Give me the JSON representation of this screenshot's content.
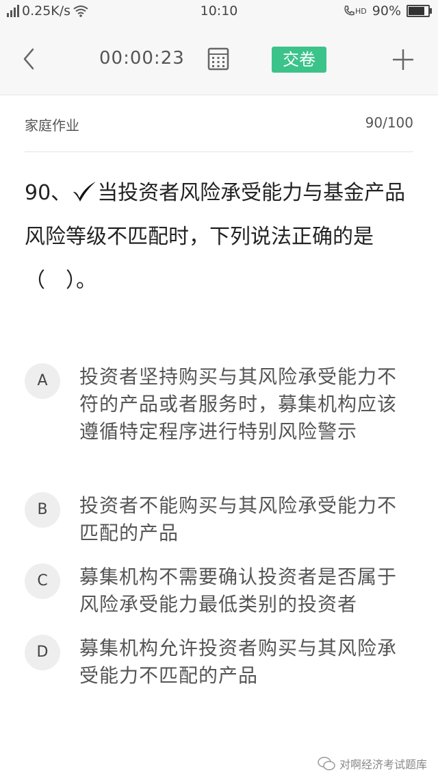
{
  "status": {
    "network_speed": "0.25K/s",
    "time": "10:10",
    "hd_label": "HD",
    "battery": "90%",
    "battery_level": 0.9
  },
  "toolbar": {
    "timer": "00:00:23",
    "submit_label": "交卷"
  },
  "section": {
    "title": "家庭作业",
    "progress": "90/100"
  },
  "question": {
    "number": "90、",
    "text": "当投资者风险承受能力与基金产品风险等级不匹配时，下列说法正确的是（　）。"
  },
  "options": [
    {
      "letter": "A",
      "text": "投资者坚持购买与其风险承受能力不符的产品或者服务时，募集机构应该遵循特定程序进行特别风险警示"
    },
    {
      "letter": "B",
      "text": "投资者不能购买与其风险承受能力不匹配的产品"
    },
    {
      "letter": "C",
      "text": "募集机构不需要确认投资者是否属于风险承受能力最低类别的投资者"
    },
    {
      "letter": "D",
      "text": "募集机构允许投资者购买与其风险承受能力不匹配的产品"
    }
  ],
  "watermark": {
    "text": "对啊经济考试题库"
  },
  "colors": {
    "accent": "#3cc38a",
    "option_circle": "#eeeeee"
  }
}
